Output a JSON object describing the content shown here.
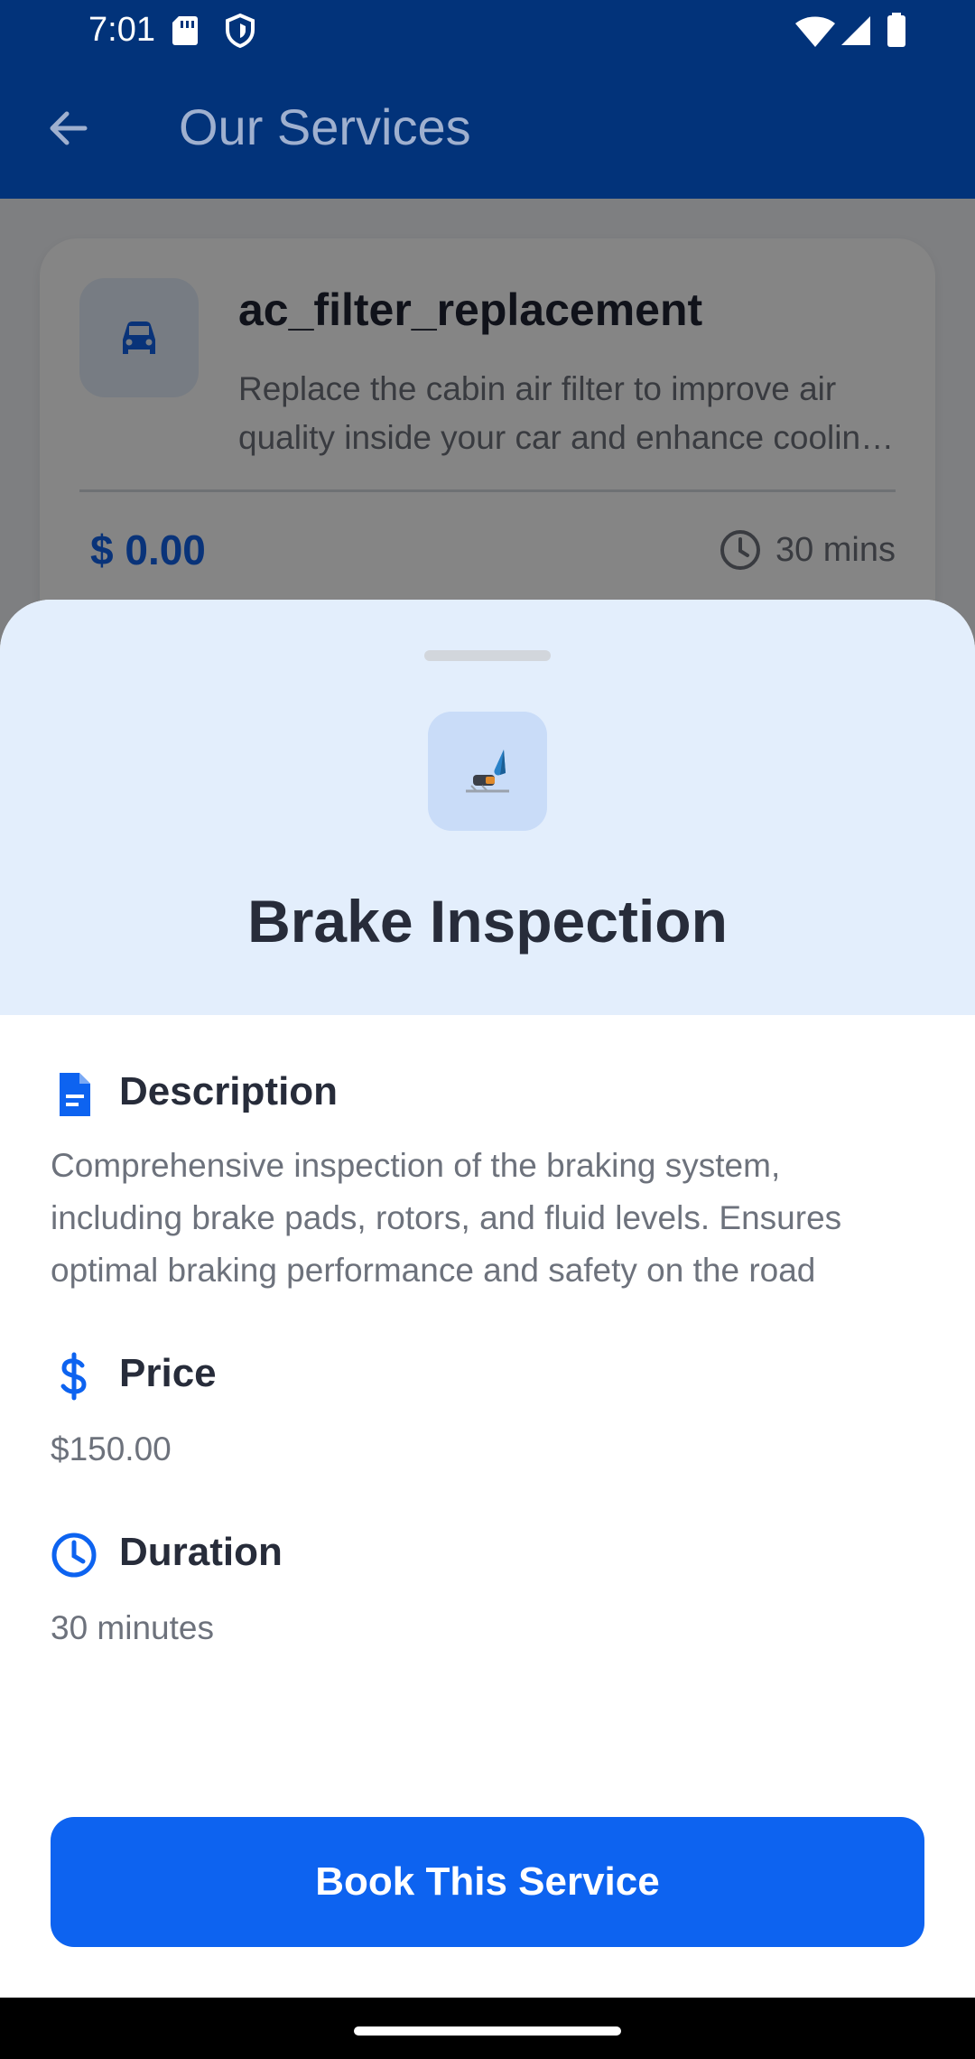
{
  "status_bar": {
    "time": "7:01",
    "left_icons": [
      "sd-card-icon",
      "shield-icon"
    ],
    "right_icons": [
      "wifi-icon",
      "signal-icon",
      "battery-icon"
    ]
  },
  "app_bar": {
    "title": "Our Services",
    "back_icon": "arrow-left-icon",
    "color": "#02337a"
  },
  "background_card": {
    "icon": "car-icon",
    "title": "ac_filter_replacement",
    "description": "Replace the cabin air filter to improve air quality inside your car and enhance cooling performance",
    "price": "$ 0.00",
    "duration": "30 mins",
    "duration_icon": "clock-icon"
  },
  "sheet": {
    "icon": "brake-pedal-icon",
    "title": "Brake Inspection",
    "description": {
      "icon": "document-icon",
      "heading": "Description",
      "text": "Comprehensive inspection of the braking system, including brake pads, rotors, and fluid levels. Ensures optimal braking performance and safety on the road"
    },
    "price": {
      "icon": "dollar-icon",
      "heading": "Price",
      "text": "$150.00"
    },
    "duration": {
      "icon": "clock-icon",
      "heading": "Duration",
      "text": "30 minutes"
    },
    "book_button": "Book This Service",
    "accent_color": "#0d63f0",
    "header_color": "#e3eefc"
  }
}
